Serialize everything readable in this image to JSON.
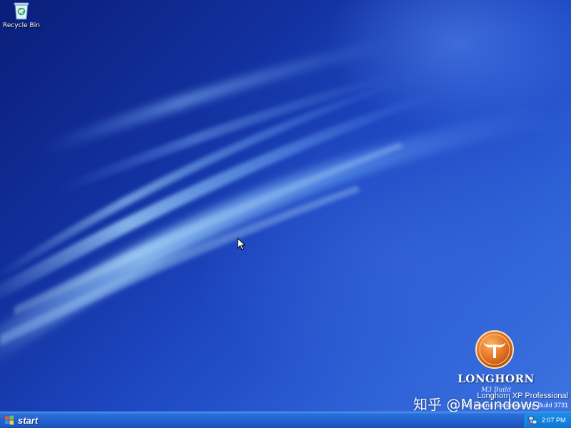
{
  "desktop": {
    "icons": [
      {
        "label": "Recycle Bin",
        "icon": "recycle-bin-icon"
      }
    ]
  },
  "branding": {
    "name": "LONGHORN",
    "subtitle": "M3 Build",
    "product": "Longhorn XP Professional",
    "build_line": "For testing purposes only. Build 3731"
  },
  "watermark": "知乎 @Macindows",
  "taskbar": {
    "start_label": "start",
    "clock": "2:07 PM"
  },
  "colors": {
    "desktop_deep": "#0a1e7a",
    "desktop_light": "#3c74df",
    "taskbar": "#245dcb",
    "tray": "#1483e0",
    "logo_orange": "#e07020"
  }
}
